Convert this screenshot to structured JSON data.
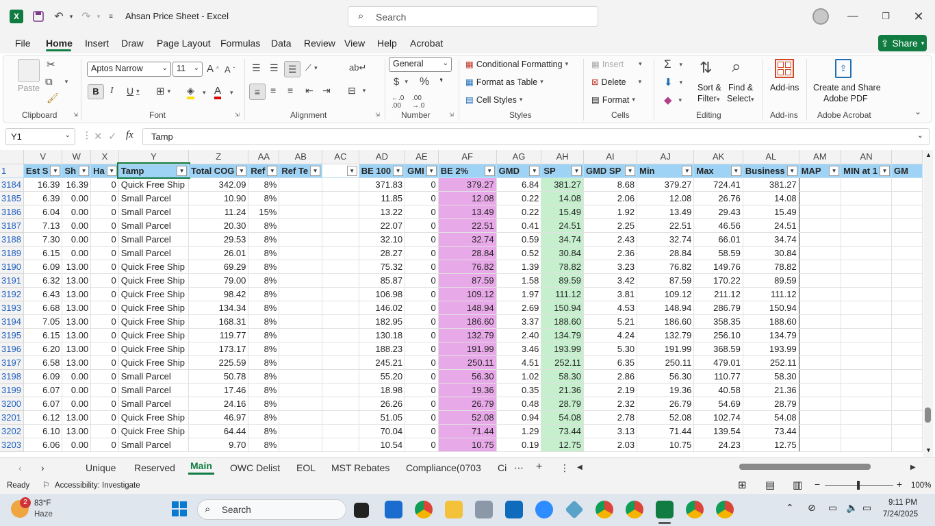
{
  "app": {
    "title": "Ahsan Price Sheet  -  Excel",
    "search_placeholder": "Search",
    "share_label": "Share"
  },
  "menu": [
    "File",
    "Home",
    "Insert",
    "Draw",
    "Page Layout",
    "Formulas",
    "Data",
    "Review",
    "View",
    "Help",
    "Acrobat"
  ],
  "ribbon": {
    "clipboard": {
      "label": "Clipboard",
      "paste": "Paste"
    },
    "font": {
      "label": "Font",
      "name": "Aptos Narrow",
      "size": "11"
    },
    "alignment": {
      "label": "Alignment"
    },
    "number": {
      "label": "Number",
      "format": "General"
    },
    "styles": {
      "label": "Styles",
      "conditional": "Conditional Formatting",
      "format_table": "Format as Table",
      "cell_styles": "Cell Styles"
    },
    "cells": {
      "label": "Cells",
      "insert": "Insert",
      "delete": "Delete",
      "format": "Format"
    },
    "editing": {
      "label": "Editing",
      "sort1": "Sort &",
      "sort2": "Filter",
      "find1": "Find &",
      "find2": "Select"
    },
    "addins": {
      "label": "Add-ins",
      "button": "Add-ins"
    },
    "acrobat": {
      "label": "Adobe Acrobat",
      "btn1": "Create and Share",
      "btn2": "Adobe PDF"
    }
  },
  "formula_bar": {
    "name_box": "Y1",
    "formula": "Tamp"
  },
  "grid": {
    "columns": [
      "V",
      "W",
      "X",
      "Y",
      "Z",
      "AA",
      "AB",
      "AC",
      "AD",
      "AE",
      "AF",
      "AG",
      "AH",
      "AI",
      "AJ",
      "AK",
      "AL",
      "AM",
      "AN",
      ""
    ],
    "header_row_number": "1",
    "headers": [
      "Est S",
      "Sh",
      "Ha",
      "Tamp",
      "Total COG",
      "Ref",
      "Ref Te",
      "",
      "BE 100",
      "GMI",
      "BE 2%",
      "GMD",
      "SP",
      "GMD SP",
      "Min",
      "Max",
      "Business",
      "MAP",
      "MIN at 1",
      "GM"
    ],
    "rows": [
      [
        "3184",
        "16.39",
        "16.39",
        "0",
        "Quick Free Ship",
        "342.09",
        "8%",
        "",
        "",
        "371.83",
        "0",
        "379.27",
        "6.84",
        "381.27",
        "8.68",
        "379.27",
        "724.41",
        "381.27",
        "",
        ""
      ],
      [
        "3185",
        "6.39",
        "0.00",
        "0",
        "Small Parcel",
        "10.90",
        "8%",
        "",
        "",
        "11.85",
        "0",
        "12.08",
        "0.22",
        "14.08",
        "2.06",
        "12.08",
        "26.76",
        "14.08",
        "",
        ""
      ],
      [
        "3186",
        "6.04",
        "0.00",
        "0",
        "Small Parcel",
        "11.24",
        "15%",
        "",
        "",
        "13.22",
        "0",
        "13.49",
        "0.22",
        "15.49",
        "1.92",
        "13.49",
        "29.43",
        "15.49",
        "",
        ""
      ],
      [
        "3187",
        "7.13",
        "0.00",
        "0",
        "Small Parcel",
        "20.30",
        "8%",
        "",
        "",
        "22.07",
        "0",
        "22.51",
        "0.41",
        "24.51",
        "2.25",
        "22.51",
        "46.56",
        "24.51",
        "",
        ""
      ],
      [
        "3188",
        "7.30",
        "0.00",
        "0",
        "Small Parcel",
        "29.53",
        "8%",
        "",
        "",
        "32.10",
        "0",
        "32.74",
        "0.59",
        "34.74",
        "2.43",
        "32.74",
        "66.01",
        "34.74",
        "",
        ""
      ],
      [
        "3189",
        "6.15",
        "0.00",
        "0",
        "Small Parcel",
        "26.01",
        "8%",
        "",
        "",
        "28.27",
        "0",
        "28.84",
        "0.52",
        "30.84",
        "2.36",
        "28.84",
        "58.59",
        "30.84",
        "",
        ""
      ],
      [
        "3190",
        "6.09",
        "13.00",
        "0",
        "Quick Free Ship",
        "69.29",
        "8%",
        "",
        "",
        "75.32",
        "0",
        "76.82",
        "1.39",
        "78.82",
        "3.23",
        "76.82",
        "149.76",
        "78.82",
        "",
        ""
      ],
      [
        "3191",
        "6.32",
        "13.00",
        "0",
        "Quick Free Ship",
        "79.00",
        "8%",
        "",
        "",
        "85.87",
        "0",
        "87.59",
        "1.58",
        "89.59",
        "3.42",
        "87.59",
        "170.22",
        "89.59",
        "",
        ""
      ],
      [
        "3192",
        "6.43",
        "13.00",
        "0",
        "Quick Free Ship",
        "98.42",
        "8%",
        "",
        "",
        "106.98",
        "0",
        "109.12",
        "1.97",
        "111.12",
        "3.81",
        "109.12",
        "211.12",
        "111.12",
        "",
        ""
      ],
      [
        "3193",
        "6.68",
        "13.00",
        "0",
        "Quick Free Ship",
        "134.34",
        "8%",
        "",
        "",
        "146.02",
        "0",
        "148.94",
        "2.69",
        "150.94",
        "4.53",
        "148.94",
        "286.79",
        "150.94",
        "",
        ""
      ],
      [
        "3194",
        "7.05",
        "13.00",
        "0",
        "Quick Free Ship",
        "168.31",
        "8%",
        "",
        "",
        "182.95",
        "0",
        "186.60",
        "3.37",
        "188.60",
        "5.21",
        "186.60",
        "358.35",
        "188.60",
        "",
        ""
      ],
      [
        "3195",
        "6.15",
        "13.00",
        "0",
        "Quick Free Ship",
        "119.77",
        "8%",
        "",
        "",
        "130.18",
        "0",
        "132.79",
        "2.40",
        "134.79",
        "4.24",
        "132.79",
        "256.10",
        "134.79",
        "",
        ""
      ],
      [
        "3196",
        "6.20",
        "13.00",
        "0",
        "Quick Free Ship",
        "173.17",
        "8%",
        "",
        "",
        "188.23",
        "0",
        "191.99",
        "3.46",
        "193.99",
        "5.30",
        "191.99",
        "368.59",
        "193.99",
        "",
        ""
      ],
      [
        "3197",
        "6.58",
        "13.00",
        "0",
        "Quick Free Ship",
        "225.59",
        "8%",
        "",
        "",
        "245.21",
        "0",
        "250.11",
        "4.51",
        "252.11",
        "6.35",
        "250.11",
        "479.01",
        "252.11",
        "",
        ""
      ],
      [
        "3198",
        "6.09",
        "0.00",
        "0",
        "Small Parcel",
        "50.78",
        "8%",
        "",
        "",
        "55.20",
        "0",
        "56.30",
        "1.02",
        "58.30",
        "2.86",
        "56.30",
        "110.77",
        "58.30",
        "",
        ""
      ],
      [
        "3199",
        "6.07",
        "0.00",
        "0",
        "Small Parcel",
        "17.46",
        "8%",
        "",
        "",
        "18.98",
        "0",
        "19.36",
        "0.35",
        "21.36",
        "2.19",
        "19.36",
        "40.58",
        "21.36",
        "",
        ""
      ],
      [
        "3200",
        "6.07",
        "0.00",
        "0",
        "Small Parcel",
        "24.16",
        "8%",
        "",
        "",
        "26.26",
        "0",
        "26.79",
        "0.48",
        "28.79",
        "2.32",
        "26.79",
        "54.69",
        "28.79",
        "",
        ""
      ],
      [
        "3201",
        "6.12",
        "13.00",
        "0",
        "Quick Free Ship",
        "46.97",
        "8%",
        "",
        "",
        "51.05",
        "0",
        "52.08",
        "0.94",
        "54.08",
        "2.78",
        "52.08",
        "102.74",
        "54.08",
        "",
        ""
      ],
      [
        "3202",
        "6.10",
        "13.00",
        "0",
        "Quick Free Ship",
        "64.44",
        "8%",
        "",
        "",
        "70.04",
        "0",
        "71.44",
        "1.29",
        "73.44",
        "3.13",
        "71.44",
        "139.54",
        "73.44",
        "",
        ""
      ],
      [
        "3203",
        "6.06",
        "0.00",
        "0",
        "Small Parcel",
        "9.70",
        "8%",
        "",
        "",
        "10.54",
        "0",
        "10.75",
        "0.19",
        "12.75",
        "2.03",
        "10.75",
        "24.23",
        "12.75",
        "",
        ""
      ]
    ]
  },
  "sheet_tabs": [
    "Unique",
    "Reserved",
    "Main",
    "OWC Delist",
    "EOL",
    "MST Rebates",
    "Compliance(0703",
    "Ci"
  ],
  "status": {
    "ready": "Ready",
    "accessibility": "Accessibility: Investigate",
    "zoom": "100%"
  },
  "taskbar": {
    "temp": "83°F",
    "weather": "Haze",
    "badge": "2",
    "search": "Search",
    "time": "9:11 PM",
    "date": "7/24/2025"
  },
  "colors": {
    "excel_green": "#107c41",
    "header_blue": "#9fd3f5",
    "pink": "#e8a9e8",
    "green_fill": "#c6efce",
    "yellow": "#ffff00"
  }
}
